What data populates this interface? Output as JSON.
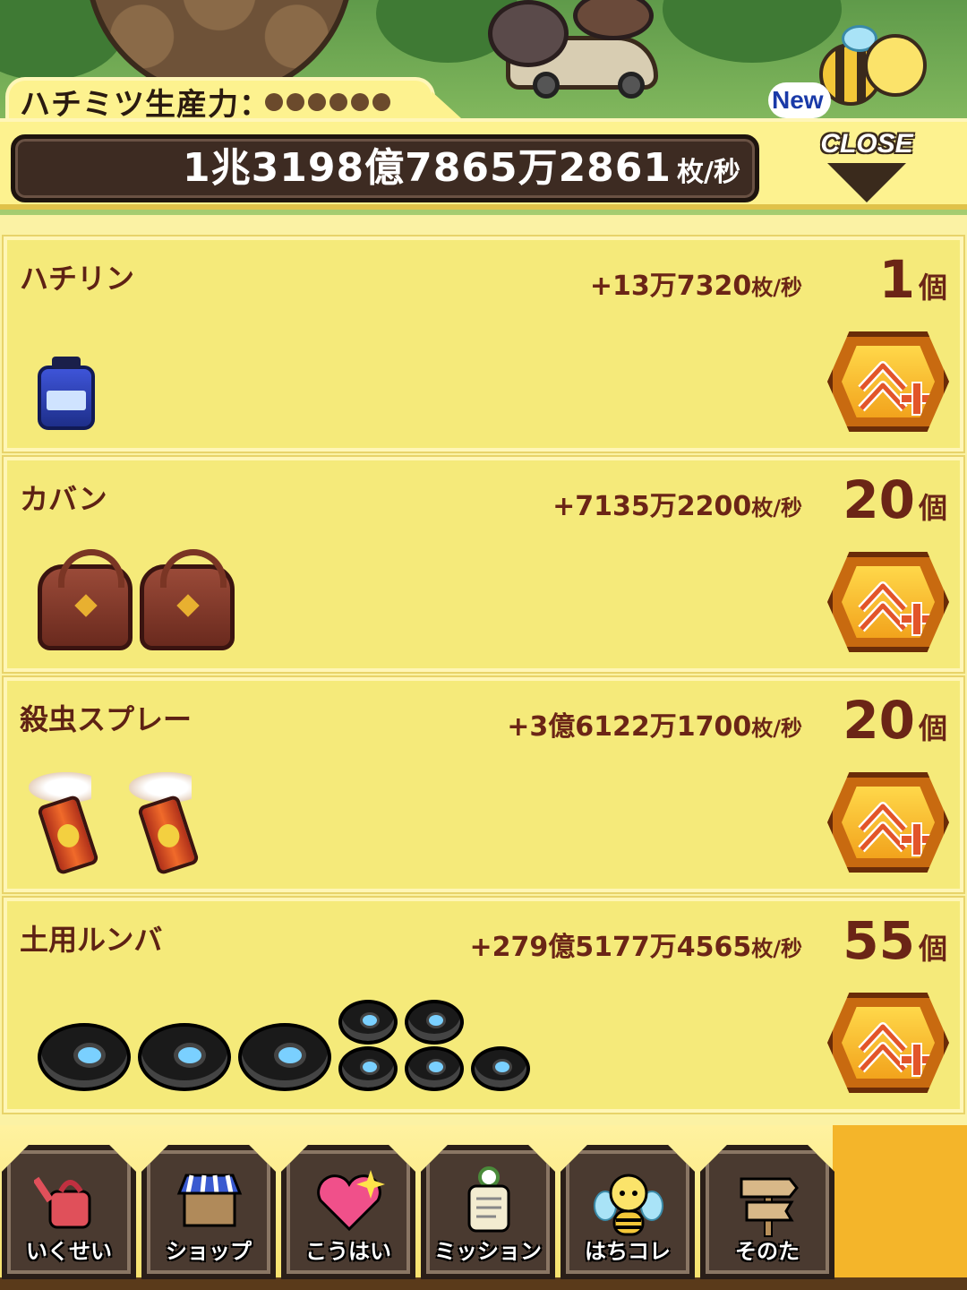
{
  "header": {
    "production_label": "ハチミツ生産力：",
    "production_dots": 6,
    "total_value": "1兆3198億7865万2861",
    "total_unit": "枚/秒",
    "close_label": "CLOSE",
    "new_badge": "New"
  },
  "items": [
    {
      "name": "ハチリン",
      "rate": "+13万7320",
      "rate_unit": "枚/秒",
      "count": "1",
      "count_unit": "個",
      "icon": "honey-bottle-icon",
      "icon_count": 1
    },
    {
      "name": "カバン",
      "rate": "+7135万2200",
      "rate_unit": "枚/秒",
      "count": "20",
      "count_unit": "個",
      "icon": "bag-icon",
      "icon_count": 2
    },
    {
      "name": "殺虫スプレー",
      "rate": "+3億6122万1700",
      "rate_unit": "枚/秒",
      "count": "20",
      "count_unit": "個",
      "icon": "spray-can-icon",
      "icon_count": 2
    },
    {
      "name": "土用ルンバ",
      "rate": "+279億5177万4565",
      "rate_unit": "枚/秒",
      "count": "55",
      "count_unit": "個",
      "icon": "robot-vacuum-icon",
      "icon_count": 8
    }
  ],
  "nav": [
    {
      "label": "いくせい",
      "icon": "watering-can-icon"
    },
    {
      "label": "ショップ",
      "icon": "shop-stall-icon"
    },
    {
      "label": "こうはい",
      "icon": "heart-icon"
    },
    {
      "label": "ミッション",
      "icon": "mission-scroll-icon"
    },
    {
      "label": "はちコレ",
      "icon": "bee-icon"
    },
    {
      "label": "そのた",
      "icon": "signpost-icon"
    }
  ],
  "colors": {
    "panel": "#fdf28f",
    "text_dark_red": "#6b2516",
    "total_box": "#3d2b22",
    "button_orange": "#f2a31c"
  }
}
